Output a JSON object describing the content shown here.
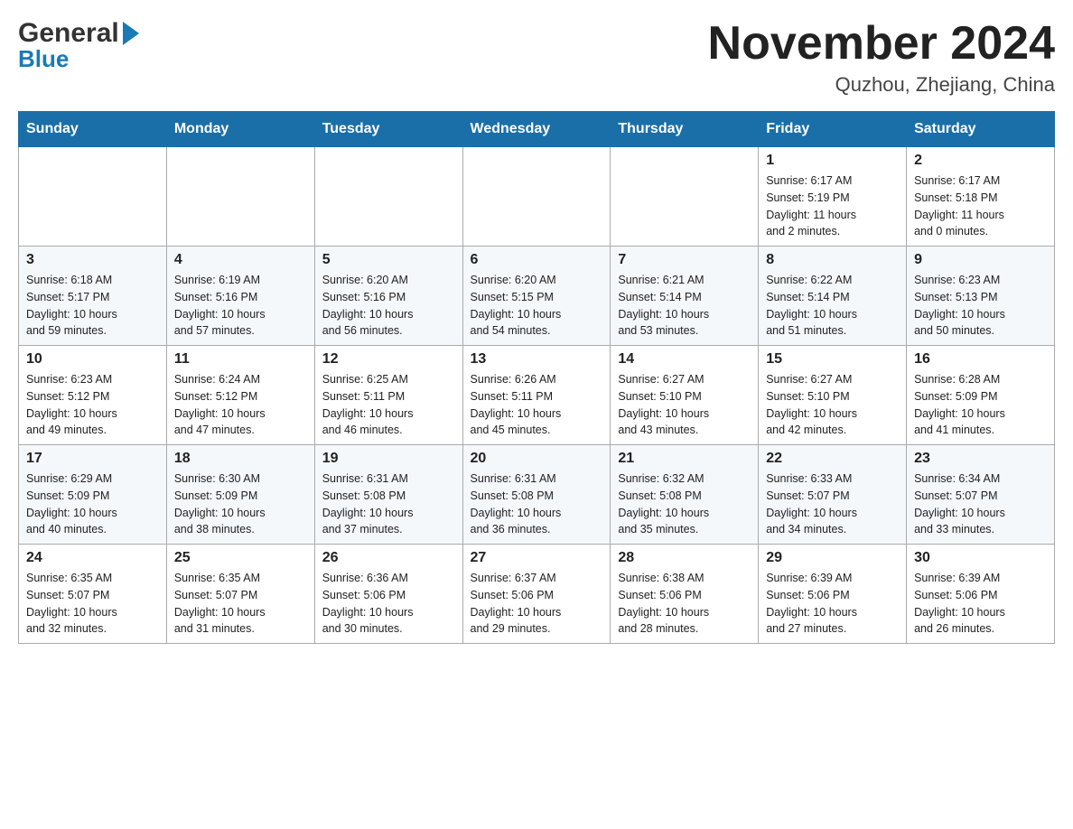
{
  "header": {
    "logo_general": "General",
    "logo_blue": "Blue",
    "month_title": "November 2024",
    "location": "Quzhou, Zhejiang, China"
  },
  "days_of_week": [
    "Sunday",
    "Monday",
    "Tuesday",
    "Wednesday",
    "Thursday",
    "Friday",
    "Saturday"
  ],
  "weeks": [
    [
      {
        "day": "",
        "info": ""
      },
      {
        "day": "",
        "info": ""
      },
      {
        "day": "",
        "info": ""
      },
      {
        "day": "",
        "info": ""
      },
      {
        "day": "",
        "info": ""
      },
      {
        "day": "1",
        "info": "Sunrise: 6:17 AM\nSunset: 5:19 PM\nDaylight: 11 hours\nand 2 minutes."
      },
      {
        "day": "2",
        "info": "Sunrise: 6:17 AM\nSunset: 5:18 PM\nDaylight: 11 hours\nand 0 minutes."
      }
    ],
    [
      {
        "day": "3",
        "info": "Sunrise: 6:18 AM\nSunset: 5:17 PM\nDaylight: 10 hours\nand 59 minutes."
      },
      {
        "day": "4",
        "info": "Sunrise: 6:19 AM\nSunset: 5:16 PM\nDaylight: 10 hours\nand 57 minutes."
      },
      {
        "day": "5",
        "info": "Sunrise: 6:20 AM\nSunset: 5:16 PM\nDaylight: 10 hours\nand 56 minutes."
      },
      {
        "day": "6",
        "info": "Sunrise: 6:20 AM\nSunset: 5:15 PM\nDaylight: 10 hours\nand 54 minutes."
      },
      {
        "day": "7",
        "info": "Sunrise: 6:21 AM\nSunset: 5:14 PM\nDaylight: 10 hours\nand 53 minutes."
      },
      {
        "day": "8",
        "info": "Sunrise: 6:22 AM\nSunset: 5:14 PM\nDaylight: 10 hours\nand 51 minutes."
      },
      {
        "day": "9",
        "info": "Sunrise: 6:23 AM\nSunset: 5:13 PM\nDaylight: 10 hours\nand 50 minutes."
      }
    ],
    [
      {
        "day": "10",
        "info": "Sunrise: 6:23 AM\nSunset: 5:12 PM\nDaylight: 10 hours\nand 49 minutes."
      },
      {
        "day": "11",
        "info": "Sunrise: 6:24 AM\nSunset: 5:12 PM\nDaylight: 10 hours\nand 47 minutes."
      },
      {
        "day": "12",
        "info": "Sunrise: 6:25 AM\nSunset: 5:11 PM\nDaylight: 10 hours\nand 46 minutes."
      },
      {
        "day": "13",
        "info": "Sunrise: 6:26 AM\nSunset: 5:11 PM\nDaylight: 10 hours\nand 45 minutes."
      },
      {
        "day": "14",
        "info": "Sunrise: 6:27 AM\nSunset: 5:10 PM\nDaylight: 10 hours\nand 43 minutes."
      },
      {
        "day": "15",
        "info": "Sunrise: 6:27 AM\nSunset: 5:10 PM\nDaylight: 10 hours\nand 42 minutes."
      },
      {
        "day": "16",
        "info": "Sunrise: 6:28 AM\nSunset: 5:09 PM\nDaylight: 10 hours\nand 41 minutes."
      }
    ],
    [
      {
        "day": "17",
        "info": "Sunrise: 6:29 AM\nSunset: 5:09 PM\nDaylight: 10 hours\nand 40 minutes."
      },
      {
        "day": "18",
        "info": "Sunrise: 6:30 AM\nSunset: 5:09 PM\nDaylight: 10 hours\nand 38 minutes."
      },
      {
        "day": "19",
        "info": "Sunrise: 6:31 AM\nSunset: 5:08 PM\nDaylight: 10 hours\nand 37 minutes."
      },
      {
        "day": "20",
        "info": "Sunrise: 6:31 AM\nSunset: 5:08 PM\nDaylight: 10 hours\nand 36 minutes."
      },
      {
        "day": "21",
        "info": "Sunrise: 6:32 AM\nSunset: 5:08 PM\nDaylight: 10 hours\nand 35 minutes."
      },
      {
        "day": "22",
        "info": "Sunrise: 6:33 AM\nSunset: 5:07 PM\nDaylight: 10 hours\nand 34 minutes."
      },
      {
        "day": "23",
        "info": "Sunrise: 6:34 AM\nSunset: 5:07 PM\nDaylight: 10 hours\nand 33 minutes."
      }
    ],
    [
      {
        "day": "24",
        "info": "Sunrise: 6:35 AM\nSunset: 5:07 PM\nDaylight: 10 hours\nand 32 minutes."
      },
      {
        "day": "25",
        "info": "Sunrise: 6:35 AM\nSunset: 5:07 PM\nDaylight: 10 hours\nand 31 minutes."
      },
      {
        "day": "26",
        "info": "Sunrise: 6:36 AM\nSunset: 5:06 PM\nDaylight: 10 hours\nand 30 minutes."
      },
      {
        "day": "27",
        "info": "Sunrise: 6:37 AM\nSunset: 5:06 PM\nDaylight: 10 hours\nand 29 minutes."
      },
      {
        "day": "28",
        "info": "Sunrise: 6:38 AM\nSunset: 5:06 PM\nDaylight: 10 hours\nand 28 minutes."
      },
      {
        "day": "29",
        "info": "Sunrise: 6:39 AM\nSunset: 5:06 PM\nDaylight: 10 hours\nand 27 minutes."
      },
      {
        "day": "30",
        "info": "Sunrise: 6:39 AM\nSunset: 5:06 PM\nDaylight: 10 hours\nand 26 minutes."
      }
    ]
  ]
}
